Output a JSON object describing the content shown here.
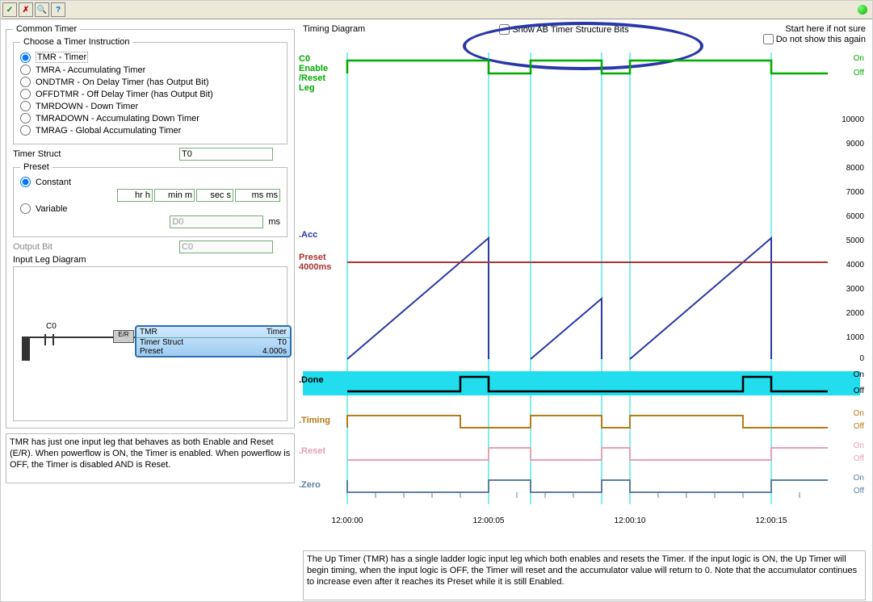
{
  "title": "Common Timer",
  "toolbar": {
    "ok": "✓",
    "cancel": "✗",
    "search": "🔍",
    "help": "?"
  },
  "instructions": {
    "legend": "Choose a Timer Instruction",
    "items": [
      {
        "label": "TMR - Timer",
        "checked": true
      },
      {
        "label": "TMRA - Accumulating Timer"
      },
      {
        "label": "ONDTMR - On Delay Timer (has Output Bit)"
      },
      {
        "label": "OFFDTMR - Off Delay Timer (has Output Bit)"
      },
      {
        "label": "TMRDOWN - Down Timer"
      },
      {
        "label": "TMRADOWN - Accumulating Down Timer"
      },
      {
        "label": "TMRAG - Global Accumulating Timer"
      }
    ]
  },
  "struct": {
    "label": "Timer Struct",
    "value": "T0"
  },
  "preset": {
    "legend": "Preset",
    "constant": "Constant",
    "variable": "Variable",
    "hr": "hr h",
    "min": "min m",
    "sec": "sec s",
    "ms": "ms ms",
    "var_value": "D0",
    "var_unit": "ms"
  },
  "output": {
    "label": "Output Bit",
    "value": "C0"
  },
  "input_leg": {
    "label": "Input Leg Diagram"
  },
  "ladder": {
    "contact": "C0",
    "er": "E/R",
    "block_hdr_l": "TMR",
    "block_hdr_r": "Timer",
    "row1_l": "Timer Struct",
    "row1_r": "T0",
    "row2_l": "Preset",
    "row2_r": "4.000s"
  },
  "left_desc": "TMR has just one input leg that behaves as both Enable and Reset (E/R).  When powerflow is ON, the Timer is enabled.  When powerflow is OFF, the Timer is disabled AND is Reset.",
  "right_header": {
    "timing": "Timing Diagram",
    "start": "Start here if not sure",
    "show_ab": "Show AB Timer Structure Bits",
    "dont_show": "Do not show this again"
  },
  "right_desc": "The Up Timer (TMR) has a single ladder logic input leg which both enables and resets the Timer. If the input logic is ON, the Up Timer will begin timing, when the input logic is OFF, the Timer will reset and the accumulator value will return to 0. Note that the accumulator continues to increase even after it reaches its Preset while it is still Enabled.",
  "chart": {
    "enable_label": "C0\nEnable\n/Reset\nLeg",
    "on": "On",
    "off": "Off",
    "acc": ".Acc",
    "preset": "Preset\n4000ms",
    "done": ".Done",
    "timing": ".Timing",
    "reset": ".Reset",
    "zero": ".Zero",
    "y_ticks": [
      "10000",
      "9000",
      "8000",
      "7000",
      "6000",
      "5000",
      "4000",
      "3000",
      "2000",
      "1000",
      "0"
    ],
    "x_ticks": [
      "12:00:00",
      "12:00:05",
      "12:00:10",
      "12:00:15"
    ]
  },
  "chart_data": {
    "type": "timing",
    "events_s": [
      0,
      5,
      6.5,
      9,
      10,
      15
    ],
    "enable": [
      1,
      0,
      1,
      0,
      1,
      0
    ],
    "preset_ms": 4000,
    "acc_max_ms": 5000,
    "y_range": [
      0,
      10000
    ],
    "x_range_s": [
      0,
      17
    ],
    "signals": [
      "enable",
      "acc",
      "done",
      "timing",
      "reset",
      "zero"
    ]
  }
}
